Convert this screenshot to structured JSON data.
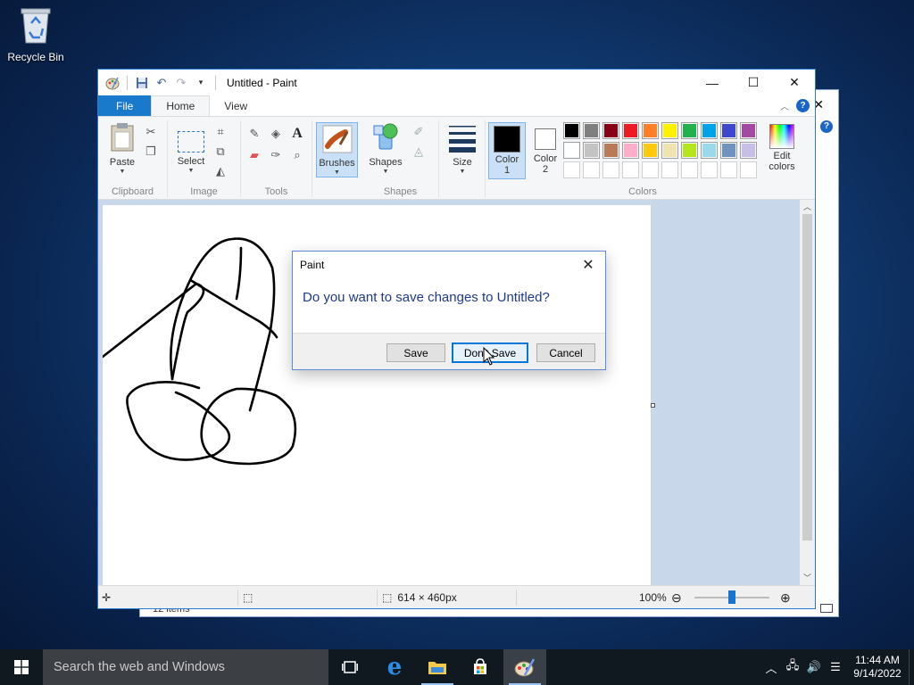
{
  "desktop": {
    "recycle_bin_label": "Recycle Bin"
  },
  "background_window": {
    "status_text": "12 items"
  },
  "paint": {
    "title": "Untitled - Paint",
    "tabs": [
      "File",
      "Home",
      "View"
    ],
    "ribbon": {
      "clipboard": {
        "paste_label": "Paste",
        "group_label": "Clipboard"
      },
      "image": {
        "select_label": "Select",
        "group_label": "Image"
      },
      "tools": {
        "group_label": "Tools"
      },
      "brushes_label": "Brushes",
      "shapes": {
        "shapes_label": "Shapes",
        "group_label": "Shapes"
      },
      "size_label": "Size",
      "color1_label": "Color",
      "color1_num": "1",
      "color2_label": "Color",
      "color2_num": "2",
      "edit_colors_label_1": "Edit",
      "edit_colors_label_2": "colors",
      "colors_group_label": "Colors",
      "palette_row1": [
        "#000000",
        "#7f7f7f",
        "#880015",
        "#ed1c24",
        "#ff7f27",
        "#fff200",
        "#22b14c",
        "#00a2e8",
        "#3f48cc",
        "#a349a4"
      ],
      "palette_row2": [
        "#ffffff",
        "#c3c3c3",
        "#b97a57",
        "#ffaec9",
        "#ffc90e",
        "#efe4b0",
        "#b5e61d",
        "#99d9ea",
        "#7092be",
        "#c8bfe7"
      ],
      "color1_value": "#000000",
      "color2_value": "#ffffff"
    },
    "status": {
      "canvas_size": "614 × 460px",
      "zoom": "100%",
      "zoom_level_fraction": 0.5
    }
  },
  "dialog": {
    "title": "Paint",
    "message": "Do you want to save changes to Untitled?",
    "save_label": "Save",
    "dont_save_label": "Don't Save",
    "cancel_label": "Cancel"
  },
  "taskbar": {
    "search_placeholder": "Search the web and Windows",
    "time": "11:44 AM",
    "date": "9/14/2022",
    "icons": [
      "task-view-icon",
      "edge-icon",
      "file-explorer-icon",
      "store-icon",
      "paint-icon"
    ]
  }
}
